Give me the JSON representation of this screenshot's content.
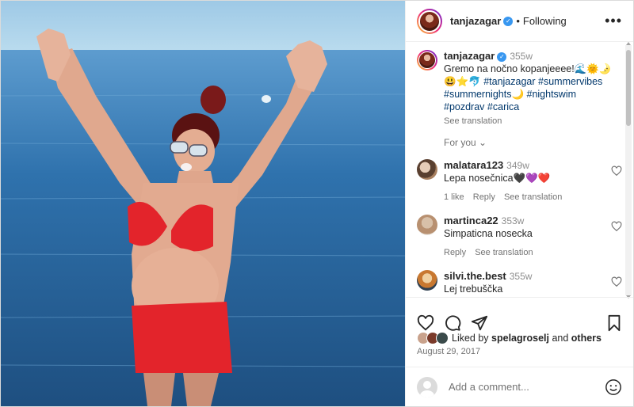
{
  "header": {
    "username": "tanjazagar",
    "verified_mark": "✓",
    "separator": "•",
    "follow_state": "Following",
    "more_icon": "more-horizontal-icon",
    "more_glyph": "•••"
  },
  "caption": {
    "username": "tanjazagar",
    "time": "355w",
    "text_line1": "Gremo na nočno kopanjeeee!🌊🌞🌛",
    "emoji_line2": "😃⭐🐬",
    "hashtags": [
      "#tanjazagar",
      "#summervibes",
      "#summernights🌙",
      "#nightswim",
      "#pozdrav",
      "#carica"
    ],
    "see_translation": "See translation"
  },
  "for_you": "For you",
  "for_you_chevron": "⌄",
  "comments": [
    {
      "username": "malatara123",
      "time": "349w",
      "text": "Lepa nosečnica🖤💜❤️",
      "likes": "1 like",
      "reply": "Reply",
      "see_translation": "See translation"
    },
    {
      "username": "martinca22",
      "time": "353w",
      "text": "Simpaticna nosecka",
      "likes": "",
      "reply": "Reply",
      "see_translation": "See translation"
    },
    {
      "username": "silvi.the.best",
      "time": "355w",
      "text": "Lej trebuščka",
      "likes": "",
      "reply": "",
      "see_translation": ""
    }
  ],
  "liked_by": {
    "prefix": "Liked by ",
    "user": "spelagroselj",
    "middle": " and ",
    "others": "others"
  },
  "date": "August 29, 2017",
  "add_comment": {
    "placeholder": "Add a comment..."
  },
  "colors": {
    "link_blue": "#00376b",
    "verified_blue": "#3897f0",
    "muted_text": "#737373",
    "swimsuit_red": "#e3242b",
    "sea_blue": "#2d6a9c"
  }
}
